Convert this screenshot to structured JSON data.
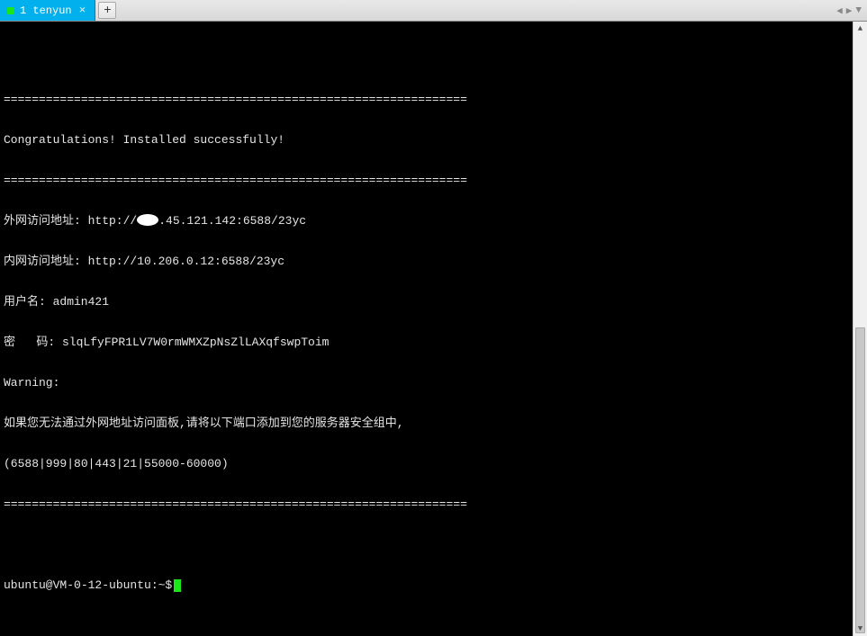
{
  "tabs": {
    "active": {
      "index": "1",
      "title": "tenyun"
    },
    "new_tab_symbol": "+",
    "close_symbol": "×",
    "nav_left": "◀",
    "nav_right": "▶",
    "nav_menu": "▼"
  },
  "terminal": {
    "divider": "==================================================================",
    "congrats": "Congratulations! Installed successfully!",
    "ext_label": "外网访问地址: http://",
    "ext_ip_partial": ".45.121.142:6588/23yc",
    "int_label": "内网访问地址: http://10.206.0.12:6588/23yc",
    "user_label": "用户名: admin421",
    "pwd_label": "密   码: slqLfyFPR1LV7W0rmWMXZpNsZlLAXqfswpToim",
    "warning_title": "Warning:",
    "warning_text": "如果您无法通过外网地址访问面板,请将以下端口添加到您的服务器安全组中,",
    "ports": "(6588|999|80|443|21|55000-60000)",
    "prompt": "ubuntu@VM-0-12-ubuntu:~$"
  }
}
